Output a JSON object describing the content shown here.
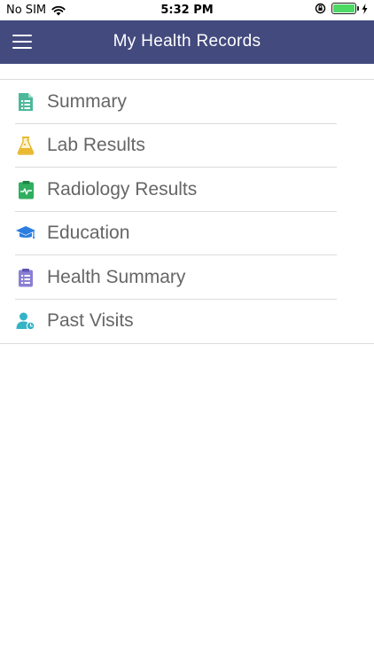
{
  "status_bar": {
    "carrier": "No SIM",
    "time": "5:32 PM"
  },
  "nav": {
    "title": "My Health Records"
  },
  "items": [
    {
      "label": "Summary",
      "icon": "document-list-icon",
      "color": "#4db89b"
    },
    {
      "label": "Lab Results",
      "icon": "flask-icon",
      "color": "#e8b931"
    },
    {
      "label": "Radiology Results",
      "icon": "clipboard-pulse-icon",
      "color": "#2fae5f"
    },
    {
      "label": "Education",
      "icon": "graduation-cap-icon",
      "color": "#2b7de0"
    },
    {
      "label": "Health Summary",
      "icon": "clipboard-list-icon",
      "color": "#8a7fd4"
    },
    {
      "label": "Past Visits",
      "icon": "user-clock-icon",
      "color": "#34b3c6"
    }
  ],
  "colors": {
    "nav_background": "#434a7e",
    "label_text": "#666666"
  }
}
